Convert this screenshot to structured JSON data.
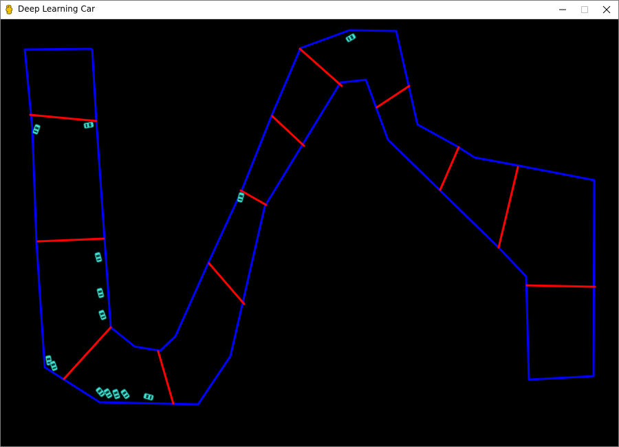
{
  "window": {
    "title": "Deep Learning Car",
    "controls": [
      "minimize",
      "maximize",
      "close"
    ]
  },
  "colors": {
    "background": "#000000",
    "track_wall": "#0000ff",
    "checkpoint": "#ff0000",
    "car": "#40e0d0"
  },
  "icons": {
    "app": "pygame-snake-icon",
    "minimize": "minimize-icon",
    "maximize": "maximize-icon",
    "close": "close-icon"
  }
}
